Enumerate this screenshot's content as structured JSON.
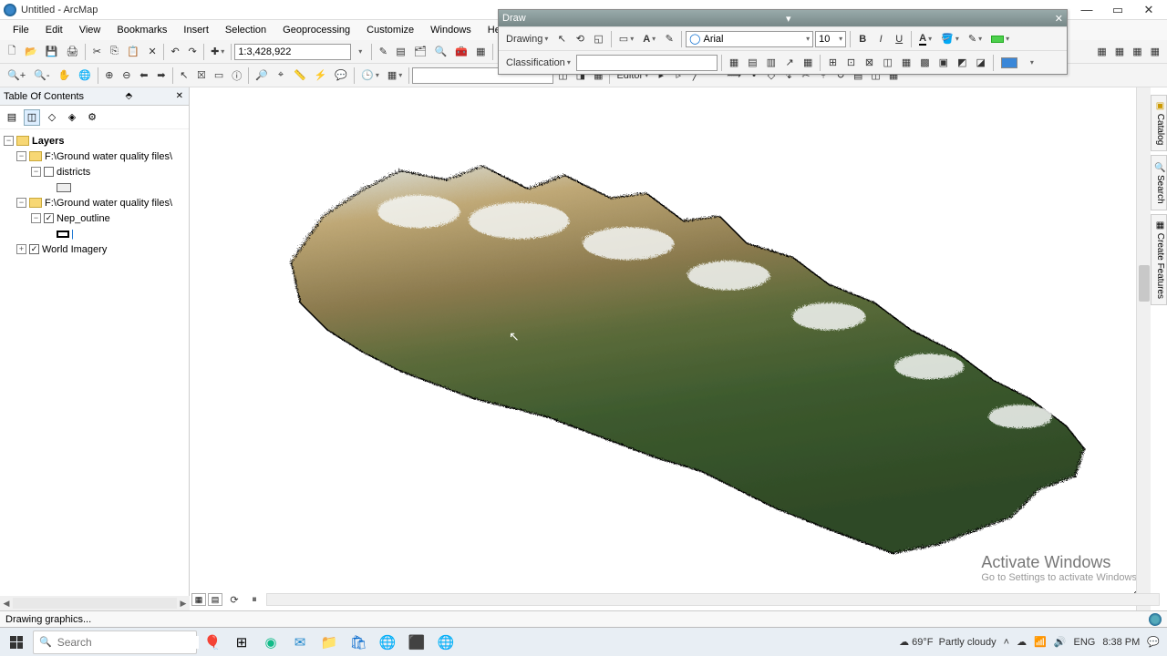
{
  "window": {
    "title": "Untitled - ArcMap"
  },
  "draw_toolbar": {
    "title": "Draw",
    "drawing_label": "Drawing",
    "classification_label": "Classification",
    "font": "Arial",
    "font_size": "10"
  },
  "menu": {
    "file": "File",
    "edit": "Edit",
    "view": "View",
    "bookmarks": "Bookmarks",
    "insert": "Insert",
    "selection": "Selection",
    "geoprocessing": "Geoprocessing",
    "customize": "Customize",
    "windows": "Windows",
    "help": "Help"
  },
  "scale": "1:3,428,922",
  "editor_label": "Editor",
  "toc": {
    "title": "Table Of Contents",
    "root": "Layers",
    "group1": "F:\\Ground water quality files\\",
    "layer_districts": "districts",
    "group2": "F:\\Ground water quality files\\",
    "layer_outline": "Nep_outline",
    "layer_imagery": "World Imagery"
  },
  "side_tabs": {
    "catalog": "Catalog",
    "search": "Search",
    "create": "Create Features"
  },
  "watermark": {
    "title": "Activate Windows",
    "sub": "Go to Settings to activate Windows."
  },
  "status": "Drawing graphics...",
  "taskbar": {
    "search_placeholder": "Search",
    "weather_temp": "69°F",
    "weather_cond": "Partly cloudy",
    "lang": "ENG",
    "time": "8:38 PM"
  }
}
